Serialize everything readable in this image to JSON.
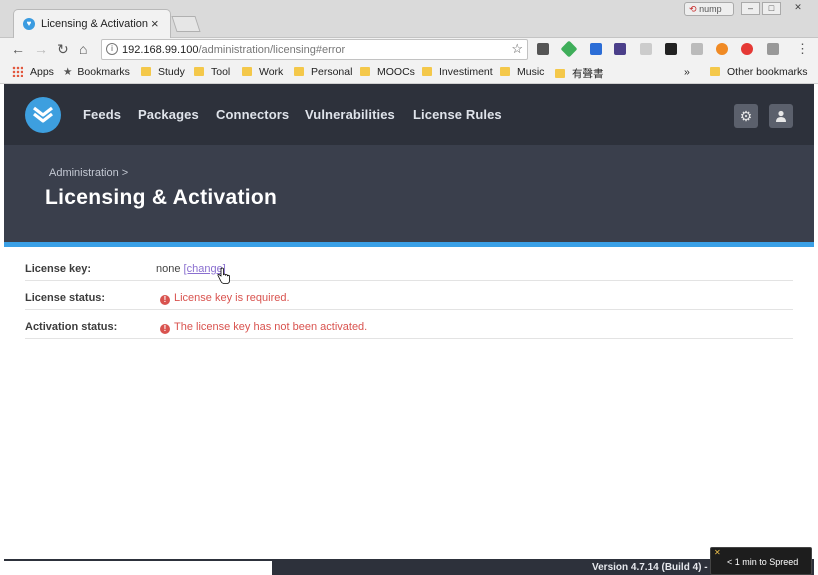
{
  "browser": {
    "tab_title": "Licensing & Activation",
    "tab_close": "×",
    "user_label": "nump",
    "url_host": "192.168.99.100",
    "url_path": "/administration/licensing#error",
    "bookmarks": {
      "apps": "Apps",
      "bookmarks": "Bookmarks",
      "folders": [
        "Study",
        "Tool",
        "Work",
        "Personal",
        "MOOCs",
        "Investiment",
        "Music",
        "有聲書"
      ],
      "overflow": "»",
      "other": "Other bookmarks"
    }
  },
  "app": {
    "nav": [
      "Feeds",
      "Packages",
      "Connectors",
      "Vulnerabilities",
      "License Rules"
    ],
    "breadcrumb": "Administration >",
    "title": "Licensing & Activation",
    "rows": [
      {
        "label": "License key:",
        "value": "none",
        "link": "[change]"
      },
      {
        "label": "License status:",
        "value": "License key is required."
      },
      {
        "label": "Activation status:",
        "value": "The license key has not been activated."
      }
    ],
    "version": "Version 4.7.14 (Build 4) -",
    "popup": "< 1 min to Spreed",
    "colors": {
      "accent": "#3aa0e6",
      "nav_bg": "#2d313b",
      "error": "#d9534f",
      "link": "#8a6fd0"
    }
  }
}
